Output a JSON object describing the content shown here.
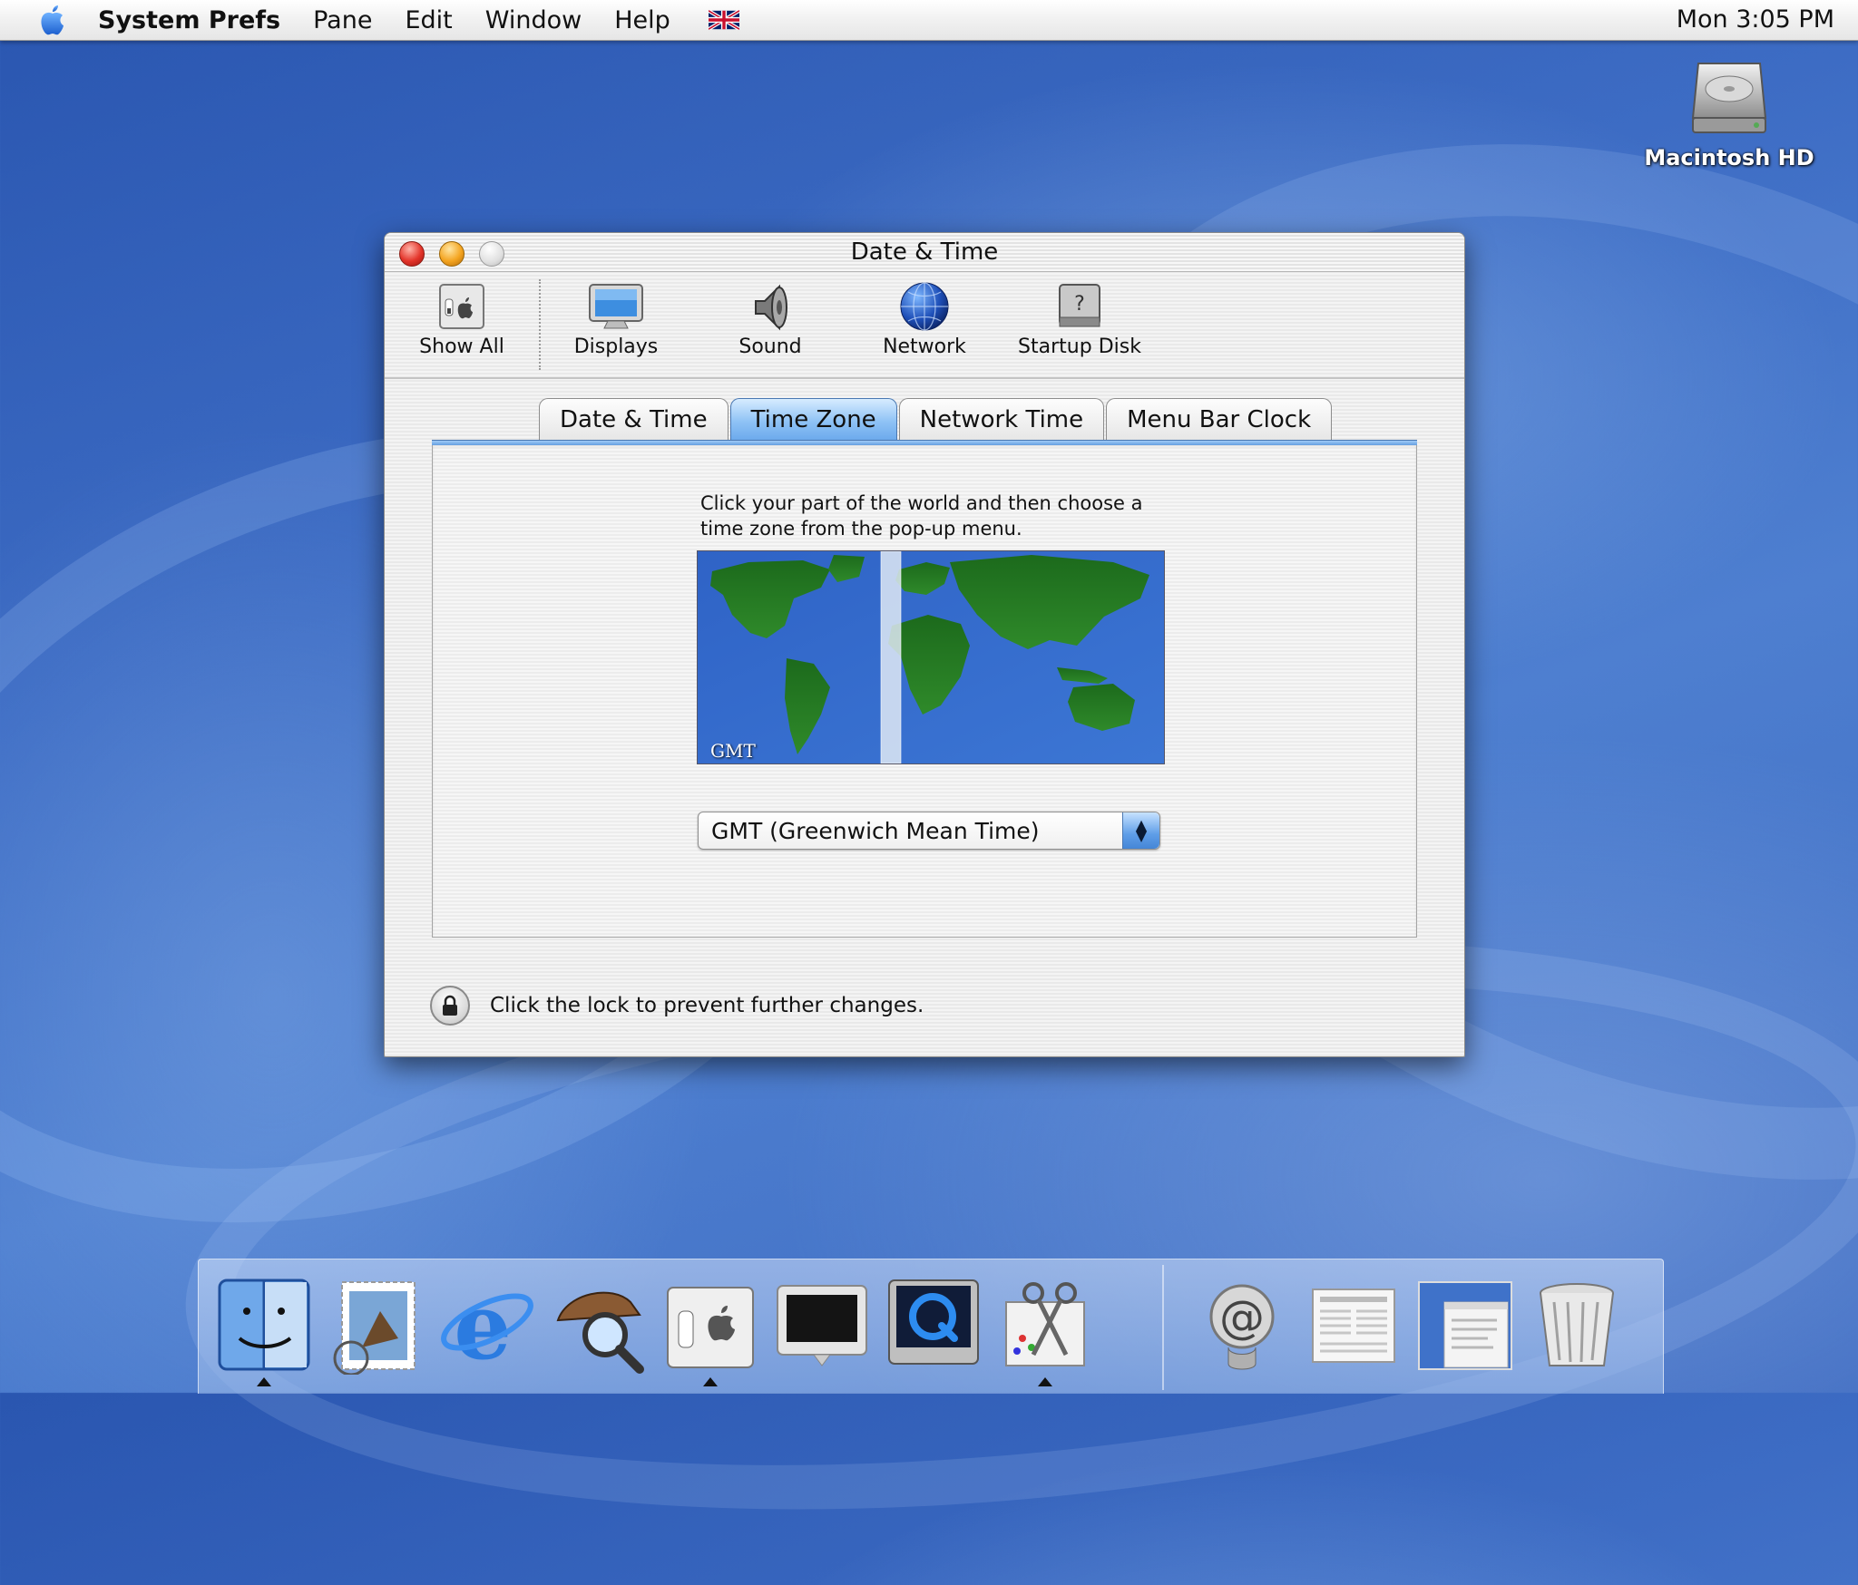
{
  "menubar": {
    "app_name": "System Prefs",
    "items": [
      "Pane",
      "Edit",
      "Window",
      "Help"
    ],
    "clock": "Mon 3:05 PM",
    "input_menu_icon": "uk-flag-icon"
  },
  "desktop": {
    "hd_label": "Macintosh HD"
  },
  "window": {
    "title": "Date & Time",
    "toolbar": [
      {
        "label": "Show All",
        "icon": "show-all-icon"
      },
      {
        "label": "Displays",
        "icon": "displays-icon"
      },
      {
        "label": "Sound",
        "icon": "speaker-icon"
      },
      {
        "label": "Network",
        "icon": "globe-icon"
      },
      {
        "label": "Startup Disk",
        "icon": "disk-icon"
      }
    ],
    "tabs": [
      "Date & Time",
      "Time Zone",
      "Network Time",
      "Menu Bar Clock"
    ],
    "active_tab": "Time Zone",
    "instructions": "Click your part of the world and then choose a time zone from the pop-up menu.",
    "map_label": "GMT",
    "timezone_popup": "GMT (Greenwich Mean Time)",
    "lock_text": "Click the lock to prevent further changes."
  },
  "dock": {
    "items": [
      {
        "name": "finder-icon",
        "running": true
      },
      {
        "name": "mail-icon",
        "running": false
      },
      {
        "name": "internet-explorer-icon",
        "running": false
      },
      {
        "name": "sherlock-icon",
        "running": false
      },
      {
        "name": "system-preferences-icon",
        "running": true
      },
      {
        "name": "monitor-icon",
        "running": false
      },
      {
        "name": "quicktime-icon",
        "running": false
      },
      {
        "name": "scissors-icon",
        "running": true
      },
      {
        "name": "internet-connect-icon",
        "running": false
      },
      {
        "name": "newspaper-icon",
        "running": false
      },
      {
        "name": "minimized-window-icon",
        "running": false
      },
      {
        "name": "trash-icon",
        "running": false
      }
    ]
  },
  "colors": {
    "accent_blue": "#6ba9ec",
    "desktop_blue": "#3d6cc4"
  }
}
